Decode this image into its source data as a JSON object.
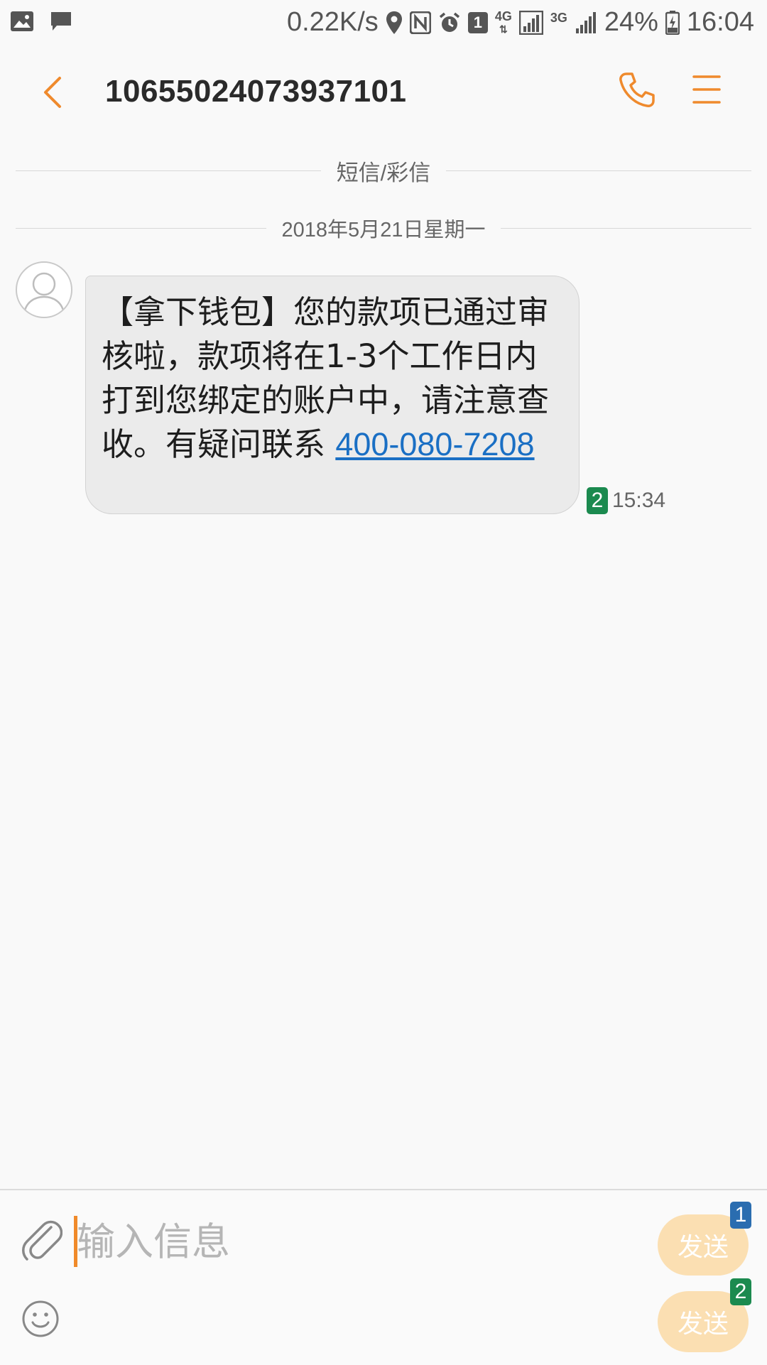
{
  "status_bar": {
    "network_speed": "0.22K/s",
    "sim_slot": "1",
    "net_4g": "4G",
    "net_3g": "3G",
    "battery": "24%",
    "time": "16:04"
  },
  "header": {
    "title": "10655024073937101"
  },
  "conversation": {
    "type_label": "短信/彩信",
    "date_label": "2018年5月21日星期一",
    "message": {
      "text": "【拿下钱包】您的款项已通过审核啦，款项将在1-3个工作日内打到您绑定的账户中，请注意查收。有疑问联系 ",
      "link": "400-080-7208",
      "sim": "2",
      "time": "15:34"
    }
  },
  "composer": {
    "placeholder": "输入信息",
    "send_sim1": {
      "label": "发送",
      "sim": "1"
    },
    "send_sim2": {
      "label": "发送",
      "sim": "2"
    }
  },
  "colors": {
    "accent": "#ef8a2d",
    "link": "#1a6fc4",
    "sim1": "#2a6db0",
    "sim2": "#1b8a4f",
    "send_disabled": "#fbdfb2"
  }
}
